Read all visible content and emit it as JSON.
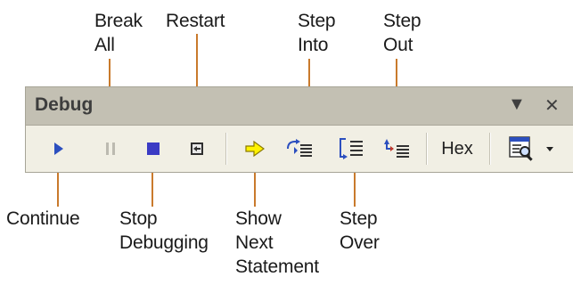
{
  "toolbar": {
    "title": "Debug",
    "dropdown_glyph": "▼",
    "close_glyph": "✕",
    "hex_label": "Hex"
  },
  "callouts": {
    "continue": "Continue",
    "break_all": "Break\nAll",
    "stop_debugging": "Stop\nDebugging",
    "restart": "Restart",
    "show_next_statement": "Show\nNext\nStatement",
    "step_into": "Step\nInto",
    "step_over": "Step\nOver",
    "step_out": "Step\nOut"
  },
  "icons": {
    "continue": "play-icon",
    "break_all": "pause-icon",
    "stop_debugging": "stop-icon",
    "restart": "restart-icon",
    "show_next_statement": "arrow-right-icon",
    "step_into": "step-into-icon",
    "step_over": "step-over-icon",
    "step_out": "step-out-icon",
    "breakpoints": "breakpoints-window-icon"
  },
  "colors": {
    "leader": "#c97a2c",
    "play": "#2c4fbf",
    "stop": "#3b3bc4",
    "arrow_fill": "#fff200"
  }
}
